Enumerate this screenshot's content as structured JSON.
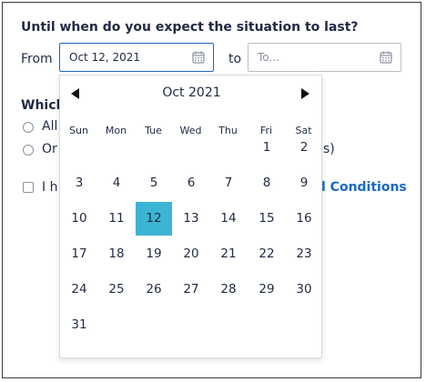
{
  "question": "Until when do you expect the situation to last?",
  "from_label": "From",
  "from_value": "Oct 12, 2021",
  "to_label": "to",
  "to_placeholder": "To...",
  "icons": {
    "calendar": "calendar-icon",
    "prev": "chevron-left-icon",
    "next": "chevron-right-icon"
  },
  "which_label": "Which",
  "options": [
    {
      "text": "All",
      "selected": false
    },
    {
      "text": "Or",
      "tail": "s)",
      "selected": false
    }
  ],
  "agreement": {
    "text": "I h",
    "link": "l Conditions",
    "checked": false
  },
  "calendar": {
    "month_label": "Oct 2021",
    "weekdays": [
      "Sun",
      "Mon",
      "Tue",
      "Wed",
      "Thu",
      "Fri",
      "Sat"
    ],
    "weeks": [
      [
        "",
        "",
        "",
        "",
        "",
        "1",
        "2"
      ],
      [
        "3",
        "4",
        "5",
        "6",
        "7",
        "8",
        "9"
      ],
      [
        "10",
        "11",
        "12",
        "13",
        "14",
        "15",
        "16"
      ],
      [
        "17",
        "18",
        "19",
        "20",
        "21",
        "22",
        "23"
      ],
      [
        "24",
        "25",
        "26",
        "27",
        "28",
        "29",
        "30"
      ],
      [
        "31",
        "",
        "",
        "",
        "",
        "",
        ""
      ]
    ],
    "selected_day": "12",
    "selected_color": "#3cb4d4"
  },
  "colors": {
    "accent": "#1769c9",
    "text": "#1f2a44",
    "selected": "#3cb4d4"
  }
}
